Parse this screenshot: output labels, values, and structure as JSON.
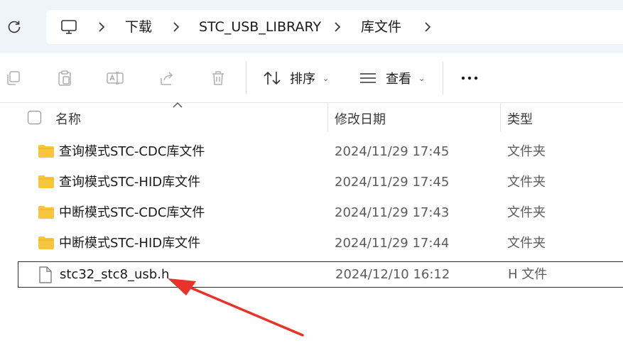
{
  "nav": {
    "breadcrumbs": [
      "下载",
      "STC_USB_LIBRARY",
      "库文件"
    ]
  },
  "toolbar": {
    "sort_label": "排序",
    "view_label": "查看"
  },
  "columns": {
    "name": "名称",
    "date": "修改日期",
    "type": "类型"
  },
  "files": [
    {
      "name": "查询模式STC-CDC库文件",
      "date": "2024/11/29 17:45",
      "type": "文件夹",
      "kind": "folder"
    },
    {
      "name": "查询模式STC-HID库文件",
      "date": "2024/11/29 17:45",
      "type": "文件夹",
      "kind": "folder"
    },
    {
      "name": "中断模式STC-CDC库文件",
      "date": "2024/11/29 17:43",
      "type": "文件夹",
      "kind": "folder"
    },
    {
      "name": "中断模式STC-HID库文件",
      "date": "2024/11/29 17:44",
      "type": "文件夹",
      "kind": "folder"
    },
    {
      "name": "stc32_stc8_usb.h",
      "date": "2024/12/10 16:12",
      "type": "H 文件",
      "kind": "file",
      "selected": true
    }
  ],
  "colors": {
    "addressbar_bg": "#eff4f9",
    "folder_yellow": "#f8c63d",
    "annotation_arrow": "#e8332a"
  }
}
